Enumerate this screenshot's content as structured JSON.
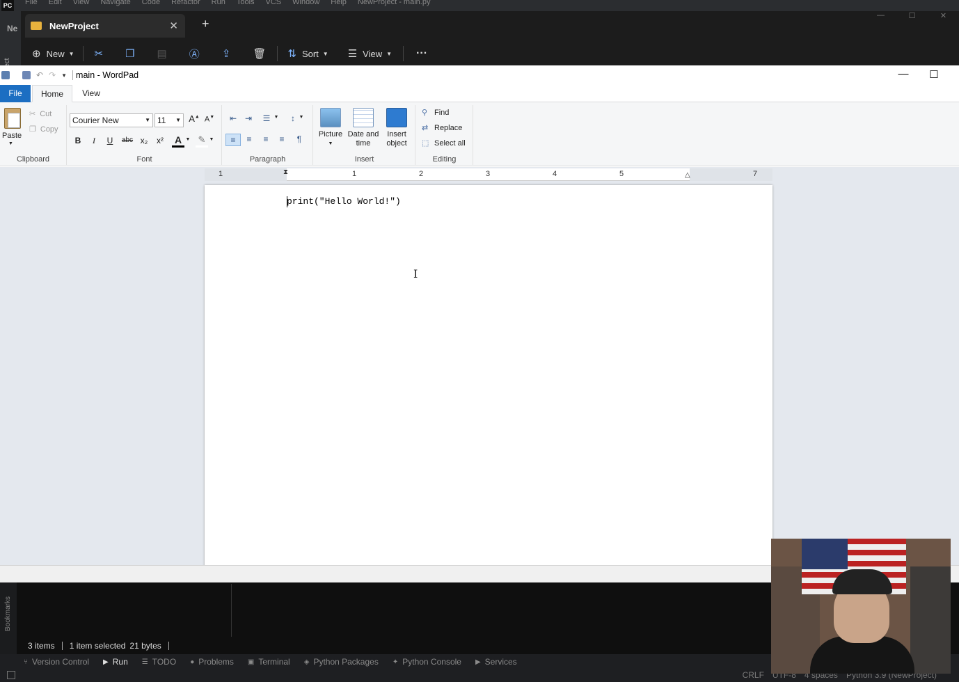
{
  "pycharm": {
    "logo": "PC",
    "menu": [
      "File",
      "Edit",
      "View",
      "Navigate",
      "Code",
      "Refactor",
      "Run",
      "Tools",
      "VCS",
      "Window",
      "Help",
      "NewProject - main.py"
    ],
    "left_label": "Ne",
    "project_label": "roject",
    "bookmarks_label": "Bookmarks",
    "toolwindows": [
      {
        "icon": "branch-icon",
        "label": "Version Control"
      },
      {
        "icon": "play-icon",
        "label": "Run"
      },
      {
        "icon": "list-icon",
        "label": "TODO"
      },
      {
        "icon": "problems-icon",
        "label": "Problems"
      },
      {
        "icon": "terminal-icon",
        "label": "Terminal"
      },
      {
        "icon": "packages-icon",
        "label": "Python Packages"
      },
      {
        "icon": "console-icon",
        "label": "Python Console"
      },
      {
        "icon": "services-icon",
        "label": "Services"
      }
    ],
    "status": {
      "line_sep": "CRLF",
      "encoding": "UTF-8",
      "indent": "4 spaces",
      "interpreter": "Python 3.9 (NewProject)"
    }
  },
  "explorer": {
    "tab_title": "NewProject",
    "tab_close": "✕",
    "new_tab": "+",
    "toolbar": {
      "new": "New",
      "sort": "Sort",
      "view": "View",
      "more": "···"
    },
    "status": {
      "items": "3 items",
      "selected": "1 item selected",
      "size": "21 bytes"
    }
  },
  "wordpad": {
    "title": "main - WordPad",
    "tabs": {
      "file": "File",
      "home": "Home",
      "view": "View"
    },
    "clipboard": {
      "paste": "Paste",
      "cut": "Cut",
      "copy": "Copy",
      "label": "Clipboard"
    },
    "font": {
      "name": "Courier New",
      "size": "11",
      "label": "Font",
      "bold": "B",
      "italic": "I",
      "underline": "U",
      "strike": "abc",
      "sub": "x₂",
      "sup": "x²"
    },
    "paragraph": {
      "label": "Paragraph"
    },
    "insert": {
      "picture": "Picture",
      "date_time_1": "Date and",
      "date_time_2": "time",
      "insert_object_1": "Insert",
      "insert_object_2": "object",
      "label": "Insert"
    },
    "editing": {
      "find": "Find",
      "replace": "Replace",
      "select_all": "Select all",
      "label": "Editing"
    },
    "ruler_numbers": [
      "1",
      "1",
      "2",
      "3",
      "4",
      "5",
      "7"
    ],
    "document_text": "print(\"Hello World!\")"
  },
  "colors": {
    "file_tab": "#1c6ec2",
    "explorer_bg": "#1c1c1c",
    "pycharm_bg": "#1e1f22",
    "doc_bg": "#e4e8ee"
  }
}
